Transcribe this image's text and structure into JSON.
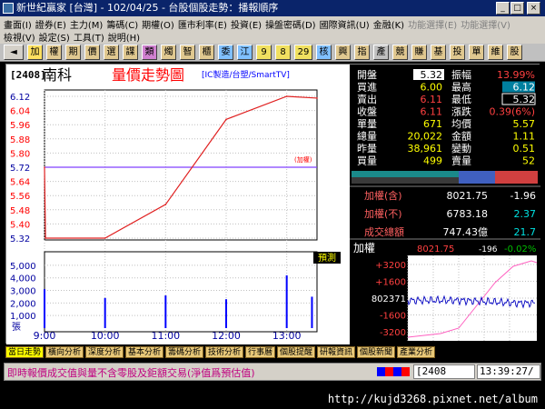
{
  "window": {
    "title": "新世紀贏家 [台灣] - 102/04/25 - 台股個股走勢：播報順序",
    "min": "_",
    "max": "□",
    "close": "×"
  },
  "menu": {
    "row1": [
      "畫面(I)",
      "證券(E)",
      "主力(M)",
      "籌碼(C)",
      "期權(O)",
      "匯市利率(E)",
      "投資(E)",
      "操盤密碼(D)",
      "國際資訊(U)",
      "金融(K)",
      "功能選擇(E)",
      "功能選擇(V)"
    ],
    "row2": [
      "檢視(V)",
      "設定(S)",
      "工具(T)",
      "說明(H)"
    ]
  },
  "toolbar": {
    "buttons": [
      "加",
      "權",
      "期",
      "價",
      "選",
      "諜",
      "類",
      "燭",
      "智",
      "櫃",
      "委",
      "江",
      "9",
      "8",
      "29",
      "核",
      "興",
      "指",
      "產",
      "競",
      "賺",
      "基",
      "投",
      "單",
      "維",
      "股"
    ]
  },
  "stock": {
    "code": "[2408]",
    "name": "南科",
    "chart_title": "量價走勢圖",
    "category": "[IC製造/台塑/SmartTV]"
  },
  "quote": {
    "rows": [
      {
        "l1": "開盤",
        "v1": "5.32",
        "l2": "振幅",
        "v2": "13.99%"
      },
      {
        "l1": "買進",
        "v1": "6.00",
        "l2": "最高",
        "v2": "6.12"
      },
      {
        "l1": "賣出",
        "v1": "6.11",
        "l2": "最低",
        "v2": "5.32"
      },
      {
        "l1": "收盤",
        "v1": "6.11",
        "l2": "漲跌",
        "v2": "0.39(6%)"
      },
      {
        "l1": "單量",
        "v1": "671",
        "l2": "均價",
        "v2": "5.57"
      },
      {
        "l1": "總量",
        "v1": "20,022",
        "l2": "金額",
        "v2": "1.11"
      },
      {
        "l1": "昨量",
        "v1": "38,961",
        "l2": "變動",
        "v2": "0.51"
      },
      {
        "l1": "買量",
        "v1": "499",
        "l2": "賣量",
        "v2": "52"
      }
    ]
  },
  "index": {
    "rows": [
      {
        "label": "加權(含)",
        "value": "8021.75",
        "change": "-1.96"
      },
      {
        "label": "加權(不)",
        "value": "6783.18",
        "change": "2.37"
      },
      {
        "label": "成交總額",
        "value": "747.43億",
        "change": "21.7"
      }
    ]
  },
  "index_chart": {
    "title": "加權",
    "value": "8021.75",
    "change": "-196",
    "pct": "-0.02%",
    "yticks": [
      "+3200",
      "+1600",
      "802371",
      "-1600",
      "-3200"
    ]
  },
  "chart_data": {
    "type": "line",
    "price_ticks": [
      "6.12",
      "6.04",
      "5.96",
      "5.88",
      "5.80",
      "5.72",
      "5.64",
      "5.56",
      "5.48",
      "5.40",
      "5.32"
    ],
    "volume_ticks": [
      "5,000",
      "4,000",
      "3,000",
      "2,000",
      "1,000"
    ],
    "volume_unit": "張",
    "time_ticks": [
      "9:00",
      "10:00",
      "11:00",
      "12:00",
      "13:00"
    ],
    "ref_label": "(加權)",
    "predict_label": "預測",
    "price_x": [
      "9:00",
      "9:01",
      "10:00",
      "11:00",
      "12:00",
      "13:00",
      "13:30"
    ],
    "price_y": [
      5.72,
      5.32,
      5.32,
      5.51,
      5.99,
      6.12,
      6.11
    ],
    "volume_x": [
      "9:00",
      "10:00",
      "11:00",
      "12:00",
      "13:00",
      "13:25"
    ],
    "volume_y": [
      3100,
      2400,
      2600,
      2300,
      4200,
      2500
    ]
  },
  "bottom_tabs": [
    "當日走勢",
    "橫向分析",
    "深度分析",
    "基本分析",
    "籌碼分析",
    "技術分析",
    "行事曆",
    "個股提醒",
    "研報資訊",
    "個股新聞",
    "產業分析"
  ],
  "status": {
    "ticker": "即時報價成交值與量不含零股及鉅額交易(淨值爲預估值)",
    "code": "[2408",
    "time": "13:39:27/"
  },
  "footer": {
    "url": "http://kujd3268.pixnet.net/album"
  },
  "colors": {
    "up": "#ff0000",
    "down": "#00aa00",
    "blue": "#0000ff",
    "accent": "#ffff00"
  }
}
